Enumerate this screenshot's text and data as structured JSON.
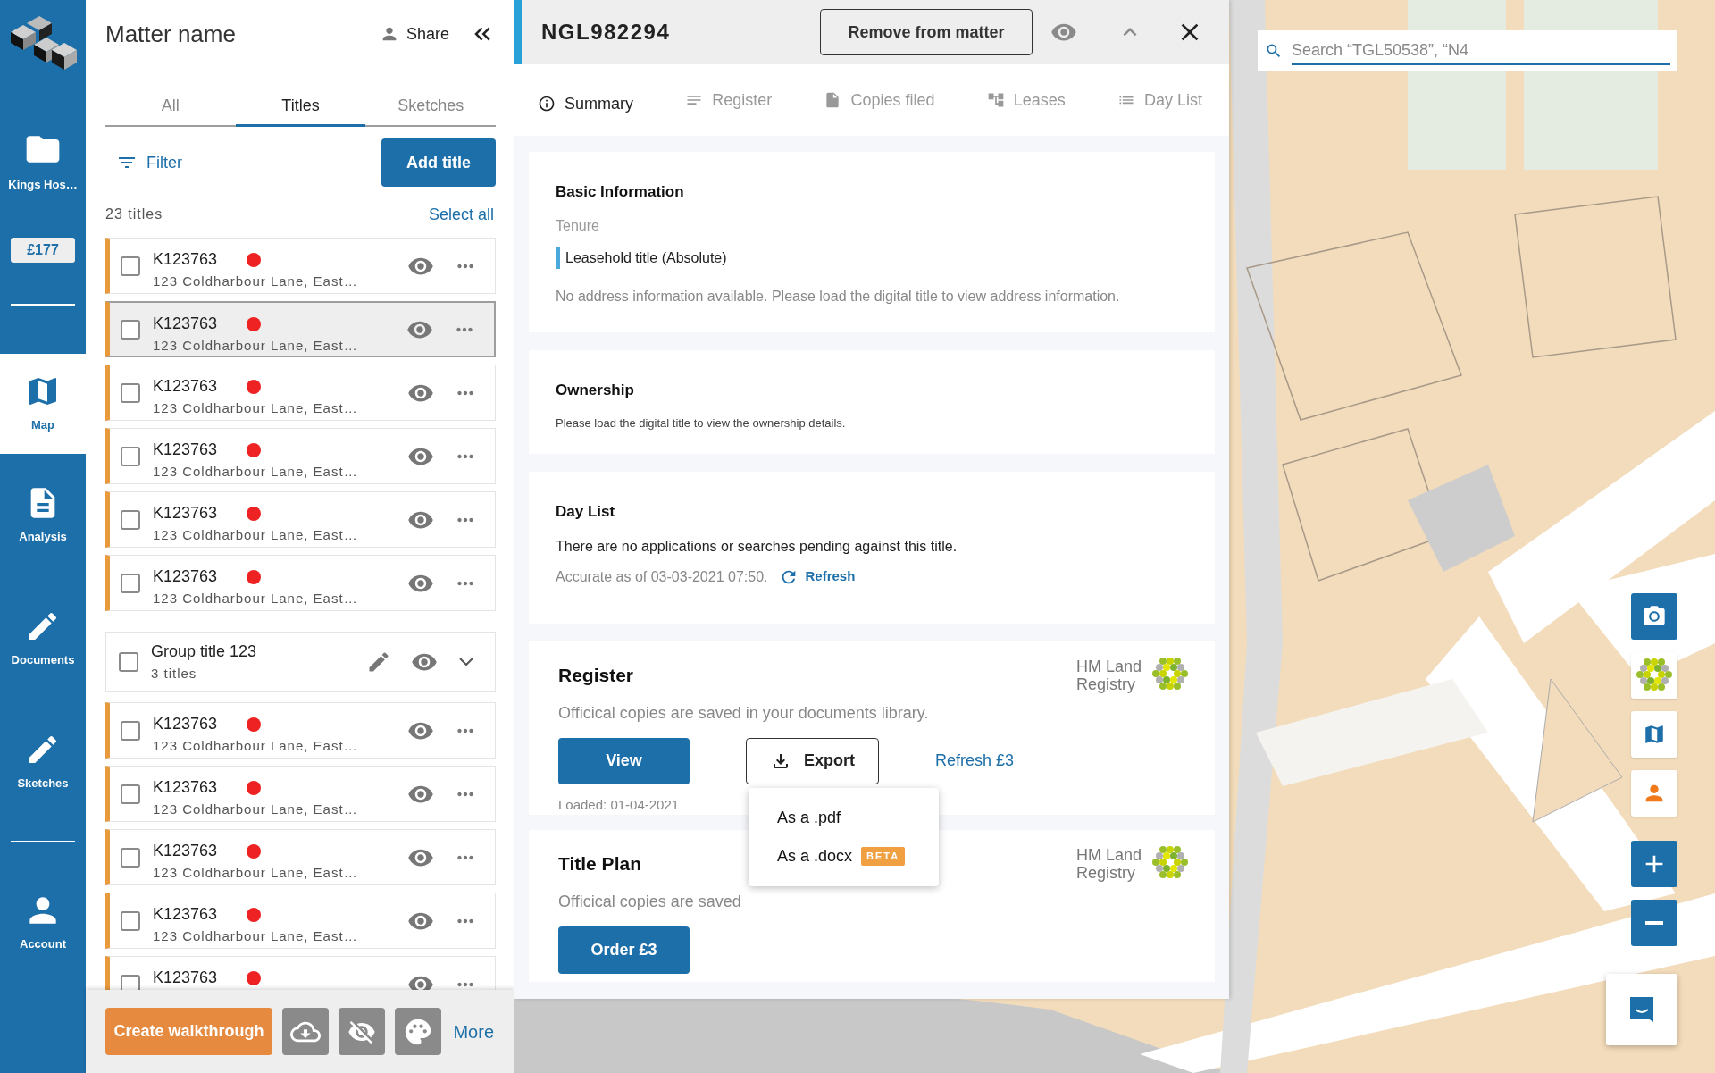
{
  "nav": {
    "matter": {
      "label": "Kings Hos…"
    },
    "credit": "£177",
    "items": [
      {
        "kind": "map",
        "label": "Map",
        "selected": true
      },
      {
        "kind": "analysis",
        "label": "Analysis",
        "selected": false
      },
      {
        "kind": "documents",
        "label": "Documents",
        "selected": false
      },
      {
        "kind": "sketches",
        "label": "Sketches",
        "selected": false
      }
    ],
    "account": {
      "label": "Account"
    }
  },
  "matter": {
    "title": "Matter name",
    "share": "Share",
    "tabs": [
      {
        "label": "All",
        "selected": false
      },
      {
        "label": "Titles",
        "selected": true
      },
      {
        "label": "Sketches",
        "selected": false
      }
    ],
    "filter": "Filter",
    "add_button": "Add title",
    "count": "23 titles",
    "select_all": "Select all",
    "rows": [
      {
        "kind": "title",
        "number": "K123763",
        "address": "123 Coldharbour Lane, East…",
        "checked": false,
        "selected": false
      },
      {
        "kind": "title",
        "number": "K123763",
        "address": "123 Coldharbour Lane, East…",
        "checked": false,
        "selected": true
      },
      {
        "kind": "title",
        "number": "K123763",
        "address": "123 Coldharbour Lane, East…",
        "checked": false,
        "selected": false
      },
      {
        "kind": "title",
        "number": "K123763",
        "address": "123 Coldharbour Lane, East…",
        "checked": false,
        "selected": false
      },
      {
        "kind": "title",
        "number": "K123763",
        "address": "123 Coldharbour Lane, East…",
        "checked": false,
        "selected": false
      },
      {
        "kind": "title",
        "number": "K123763",
        "address": "123 Coldharbour Lane, East…",
        "checked": false,
        "selected": false
      },
      {
        "kind": "group",
        "name": "Group title 123",
        "sub": "3 titles",
        "checked": false,
        "expanded": false
      },
      {
        "kind": "title",
        "number": "K123763",
        "address": "123 Coldharbour Lane, East…",
        "checked": false,
        "selected": false
      },
      {
        "kind": "title",
        "number": "K123763",
        "address": "123 Coldharbour Lane, East…",
        "checked": false,
        "selected": false
      },
      {
        "kind": "title",
        "number": "K123763",
        "address": "123 Coldharbour Lane, East…",
        "checked": false,
        "selected": false
      },
      {
        "kind": "title",
        "number": "K123763",
        "address": "123 Coldharbour Lane, East…",
        "checked": false,
        "selected": false
      },
      {
        "kind": "title",
        "number": "K123763",
        "checked": false,
        "selected": false
      }
    ],
    "footer": {
      "walkthrough": "Create walkthrough",
      "more": "More"
    }
  },
  "detail": {
    "title_number": "NGL982294",
    "remove_button": "Remove from matter",
    "tabs": [
      {
        "kind": "summary",
        "label": "Summary",
        "selected": true
      },
      {
        "kind": "register",
        "label": "Register",
        "selected": false
      },
      {
        "kind": "copies",
        "label": "Copies filed",
        "selected": false
      },
      {
        "kind": "leases",
        "label": "Leases",
        "selected": false
      },
      {
        "kind": "daylist",
        "label": "Day List",
        "selected": false
      }
    ],
    "basic": {
      "heading": "Basic Information",
      "tenure_label": "Tenure",
      "tenure": "Leasehold title (Absolute)",
      "address_note": "No address information available. Please load the digital title to view address information."
    },
    "ownership": {
      "heading": "Ownership",
      "note": "Please load the digital title to view the ownership details."
    },
    "day_list": {
      "heading": "Day List",
      "note": "There are no applications or searches pending against this title.",
      "accuracy": "Accurate as of 03-03-2021 07:50.",
      "refresh": "Refresh"
    },
    "register": {
      "heading": "Register",
      "note": "Officical copies are saved in your documents library.",
      "provider": [
        "HM Land",
        "Registry"
      ],
      "view": "View",
      "export": "Export",
      "refresh": "Refresh £3",
      "loaded": "Loaded: 01-04-2021",
      "export_menu": [
        {
          "label": "As a .pdf"
        },
        {
          "label": "As a .docx",
          "badge": "BETA"
        }
      ]
    },
    "title_plan": {
      "heading": "Title Plan",
      "note": "Officical copies are saved",
      "provider": [
        "HM Land",
        "Registry"
      ],
      "order": "Order £3"
    }
  },
  "map": {
    "search": {
      "placeholder": "Search “TGL50538”, “N4"
    }
  }
}
